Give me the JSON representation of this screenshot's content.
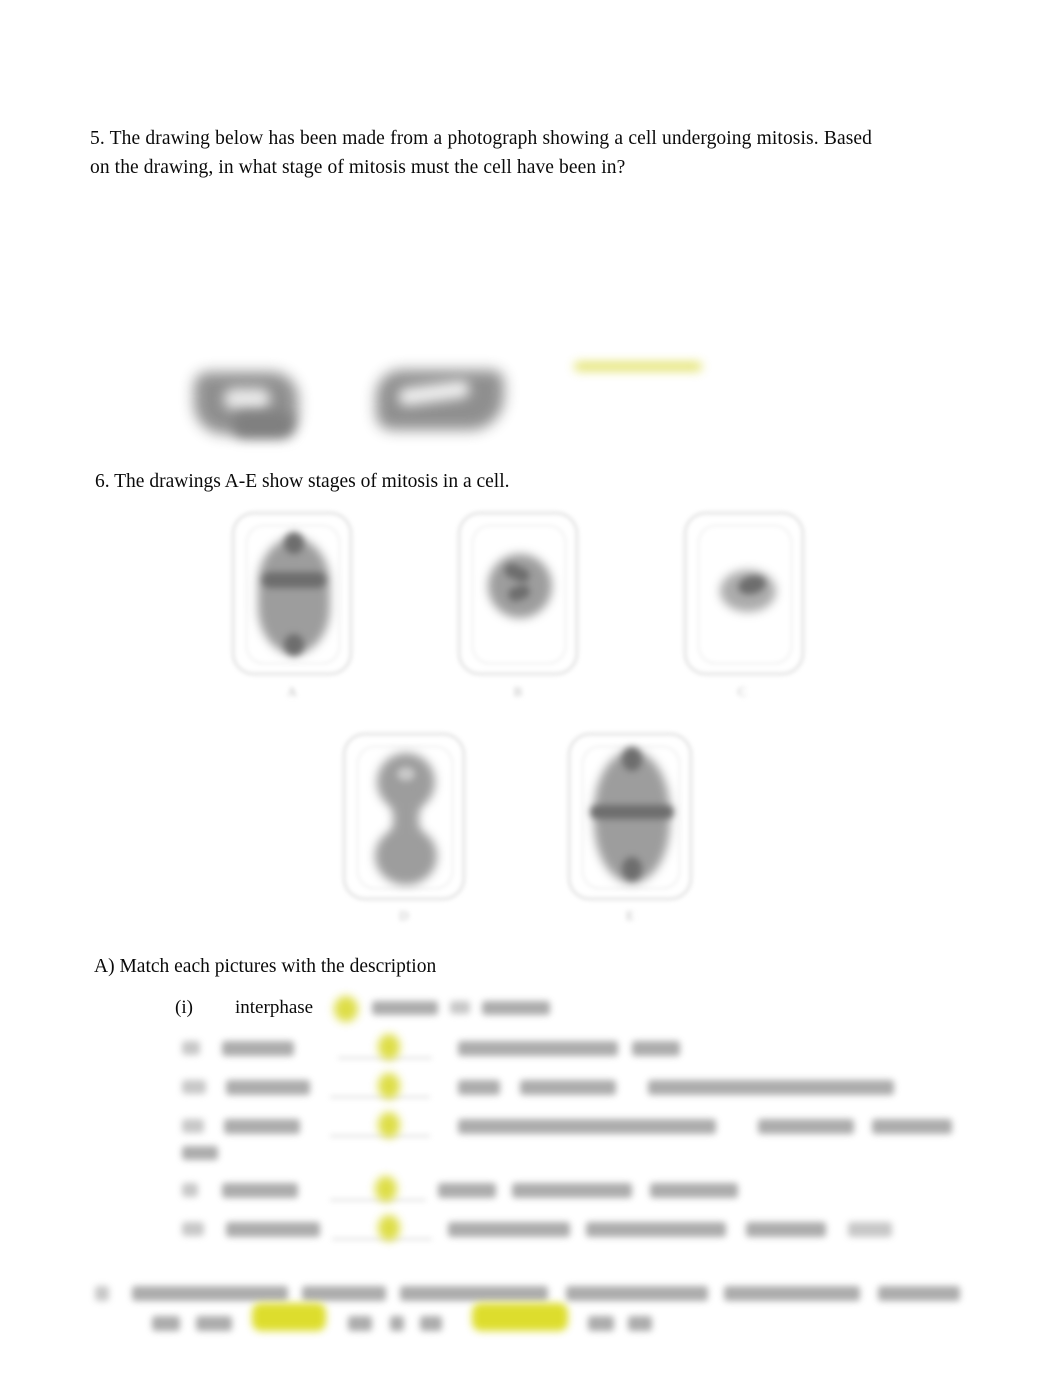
{
  "document": {
    "type": "worksheet",
    "subject": "mitosis",
    "background": "#ffffff",
    "highlight_color": "#dcdc22",
    "blur_gray": "#9a9a9a"
  },
  "question5": {
    "number": "5.",
    "text": "5.  The  drawing  below  has  been  made  from a photograph   showing  a cell undergoing mitosis.  Based   on  the  drawing,  in what  stage   of mitosis  must  the  cell  have  been   in?",
    "figure": {
      "name": "blurred-photograph-drawing",
      "legible": false,
      "parts": [
        "dark-gray-blob-left",
        "dark-gray-blob-right",
        "yellow-highlight-sliver"
      ]
    }
  },
  "question6": {
    "number": "6.",
    "text": "6.   The  drawings   A-E show  stages   of mitosis  in a cell.",
    "cells": [
      {
        "label": "A",
        "stage_hint": "anaphase-like",
        "legible": false
      },
      {
        "label": "B",
        "stage_hint": "prophase-like",
        "legible": false
      },
      {
        "label": "C",
        "stage_hint": "interphase-like",
        "legible": false
      },
      {
        "label": "D",
        "stage_hint": "telophase-like",
        "legible": false
      },
      {
        "label": "E",
        "stage_hint": "metaphase-like",
        "legible": false
      }
    ]
  },
  "partA": {
    "label": "A)   Match each pictures with the description",
    "rows": [
      {
        "numeral": "(i)",
        "term": "interphase",
        "answer_highlighted": true,
        "description_legible": false
      },
      {
        "numeral": "(ii)",
        "term": "prophase",
        "answer_highlighted": true,
        "description_legible": false
      },
      {
        "numeral": "(iii)",
        "term": "metaphase",
        "answer_highlighted": true,
        "description_legible": false
      },
      {
        "numeral": "(iv)",
        "term": "anaphase",
        "answer_highlighted": true,
        "description_legible": false
      },
      {
        "numeral": "(v)",
        "term": "telophase",
        "answer_highlighted": true,
        "description_legible": false
      },
      {
        "numeral": "(vi)",
        "term": "cytokinesis",
        "answer_highlighted": true,
        "description_legible": false
      }
    ]
  },
  "partB": {
    "label": "B)",
    "legible": false,
    "highlights": 2
  }
}
